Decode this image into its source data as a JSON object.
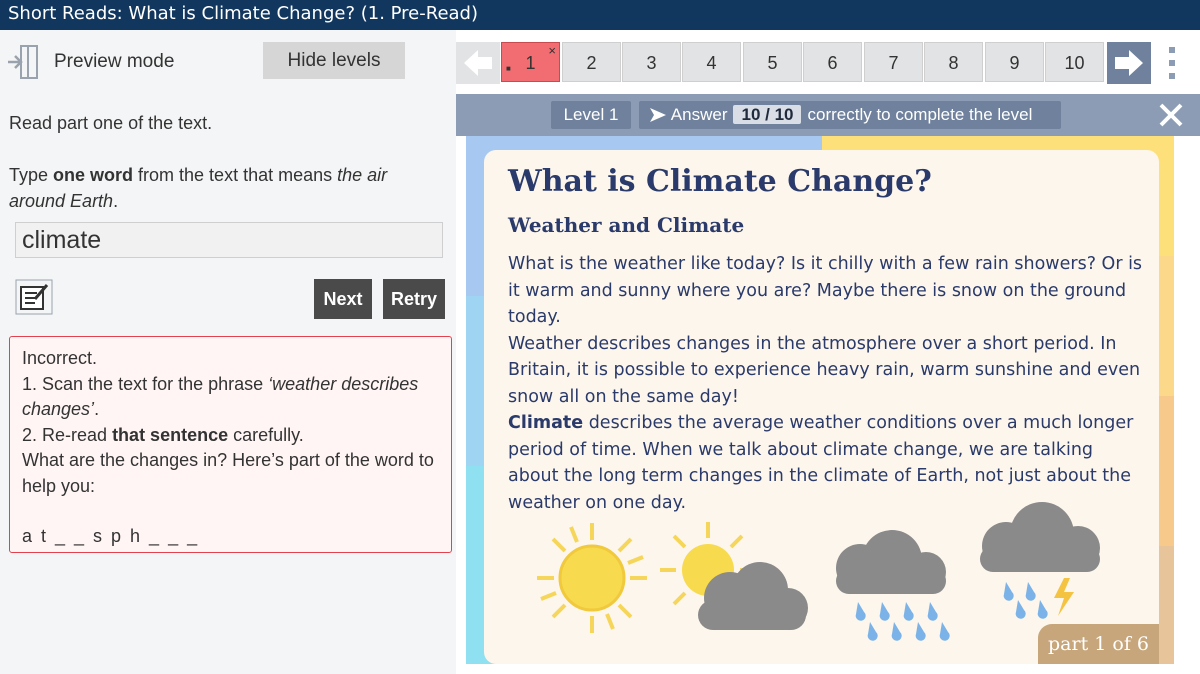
{
  "header": {
    "title": "Short Reads: What is Climate Change? (1. Pre-Read)"
  },
  "left_panel": {
    "mode_label": "Preview mode",
    "hide_levels_label": "Hide levels",
    "instruction": "Read part one of the text.",
    "question": {
      "pre": "Type ",
      "bold": "one word",
      "mid": " from the text that means ",
      "italic": "the air around Earth",
      "post": "."
    },
    "answer_value": "climate",
    "next_label": "Next",
    "retry_label": "Retry",
    "feedback": {
      "status": "Incorrect.",
      "step1_num": "1.",
      "step1_text": " Scan the text for the phrase ",
      "step1_phrase": "‘weather describes changes’",
      "step1_end": ".",
      "step2_num": "2.",
      "step2_text": " Re-read ",
      "step2_bold": "that sentence",
      "step2_end": " carefully.",
      "question": "What are the changes in? Here’s part of the word to help you:",
      "hint": "a t _ _ s p h _ _ _"
    }
  },
  "navigation": {
    "pages": [
      "1",
      "2",
      "3",
      "4",
      "5",
      "6",
      "7",
      "8",
      "9",
      "10"
    ],
    "current_page": "1",
    "current_mark": "×",
    "current_dot": "■"
  },
  "level_bar": {
    "level_label": "Level 1",
    "answer_prefix": "Answer",
    "score": "10 / 10",
    "answer_suffix": "correctly to complete the level",
    "close_symbol": "✕"
  },
  "reading": {
    "title": "What is Climate Change?",
    "subtitle": "Weather and Climate",
    "para1": "What is the weather like today? Is it chilly with a few rain showers? Or is it warm and sunny where you are? Maybe there is snow on the ground today.",
    "para2": "Weather describes changes in the atmosphere over a short period. In Britain, it is possible to experience heavy rain, warm sunshine and even snow all on the same day!",
    "para3_bold": "Climate",
    "para3": " describes the average weather conditions over a much longer period of time. When we talk about climate change, we are talking about the long term changes in the climate of Earth, not just about the weather on one day.",
    "part_label": "part 1 of 6"
  },
  "colors": {
    "header_bg": "#12375e",
    "current_page": "#f26d71",
    "feedback_border": "#e1424e",
    "level_bar": "#8b9cb4",
    "text_navy": "#2a3a6a"
  },
  "icons": [
    "exit-icon",
    "notes-icon",
    "prev-arrow-icon",
    "next-arrow-icon",
    "more-vertical-icon",
    "chevron-right-icon",
    "close-icon"
  ]
}
